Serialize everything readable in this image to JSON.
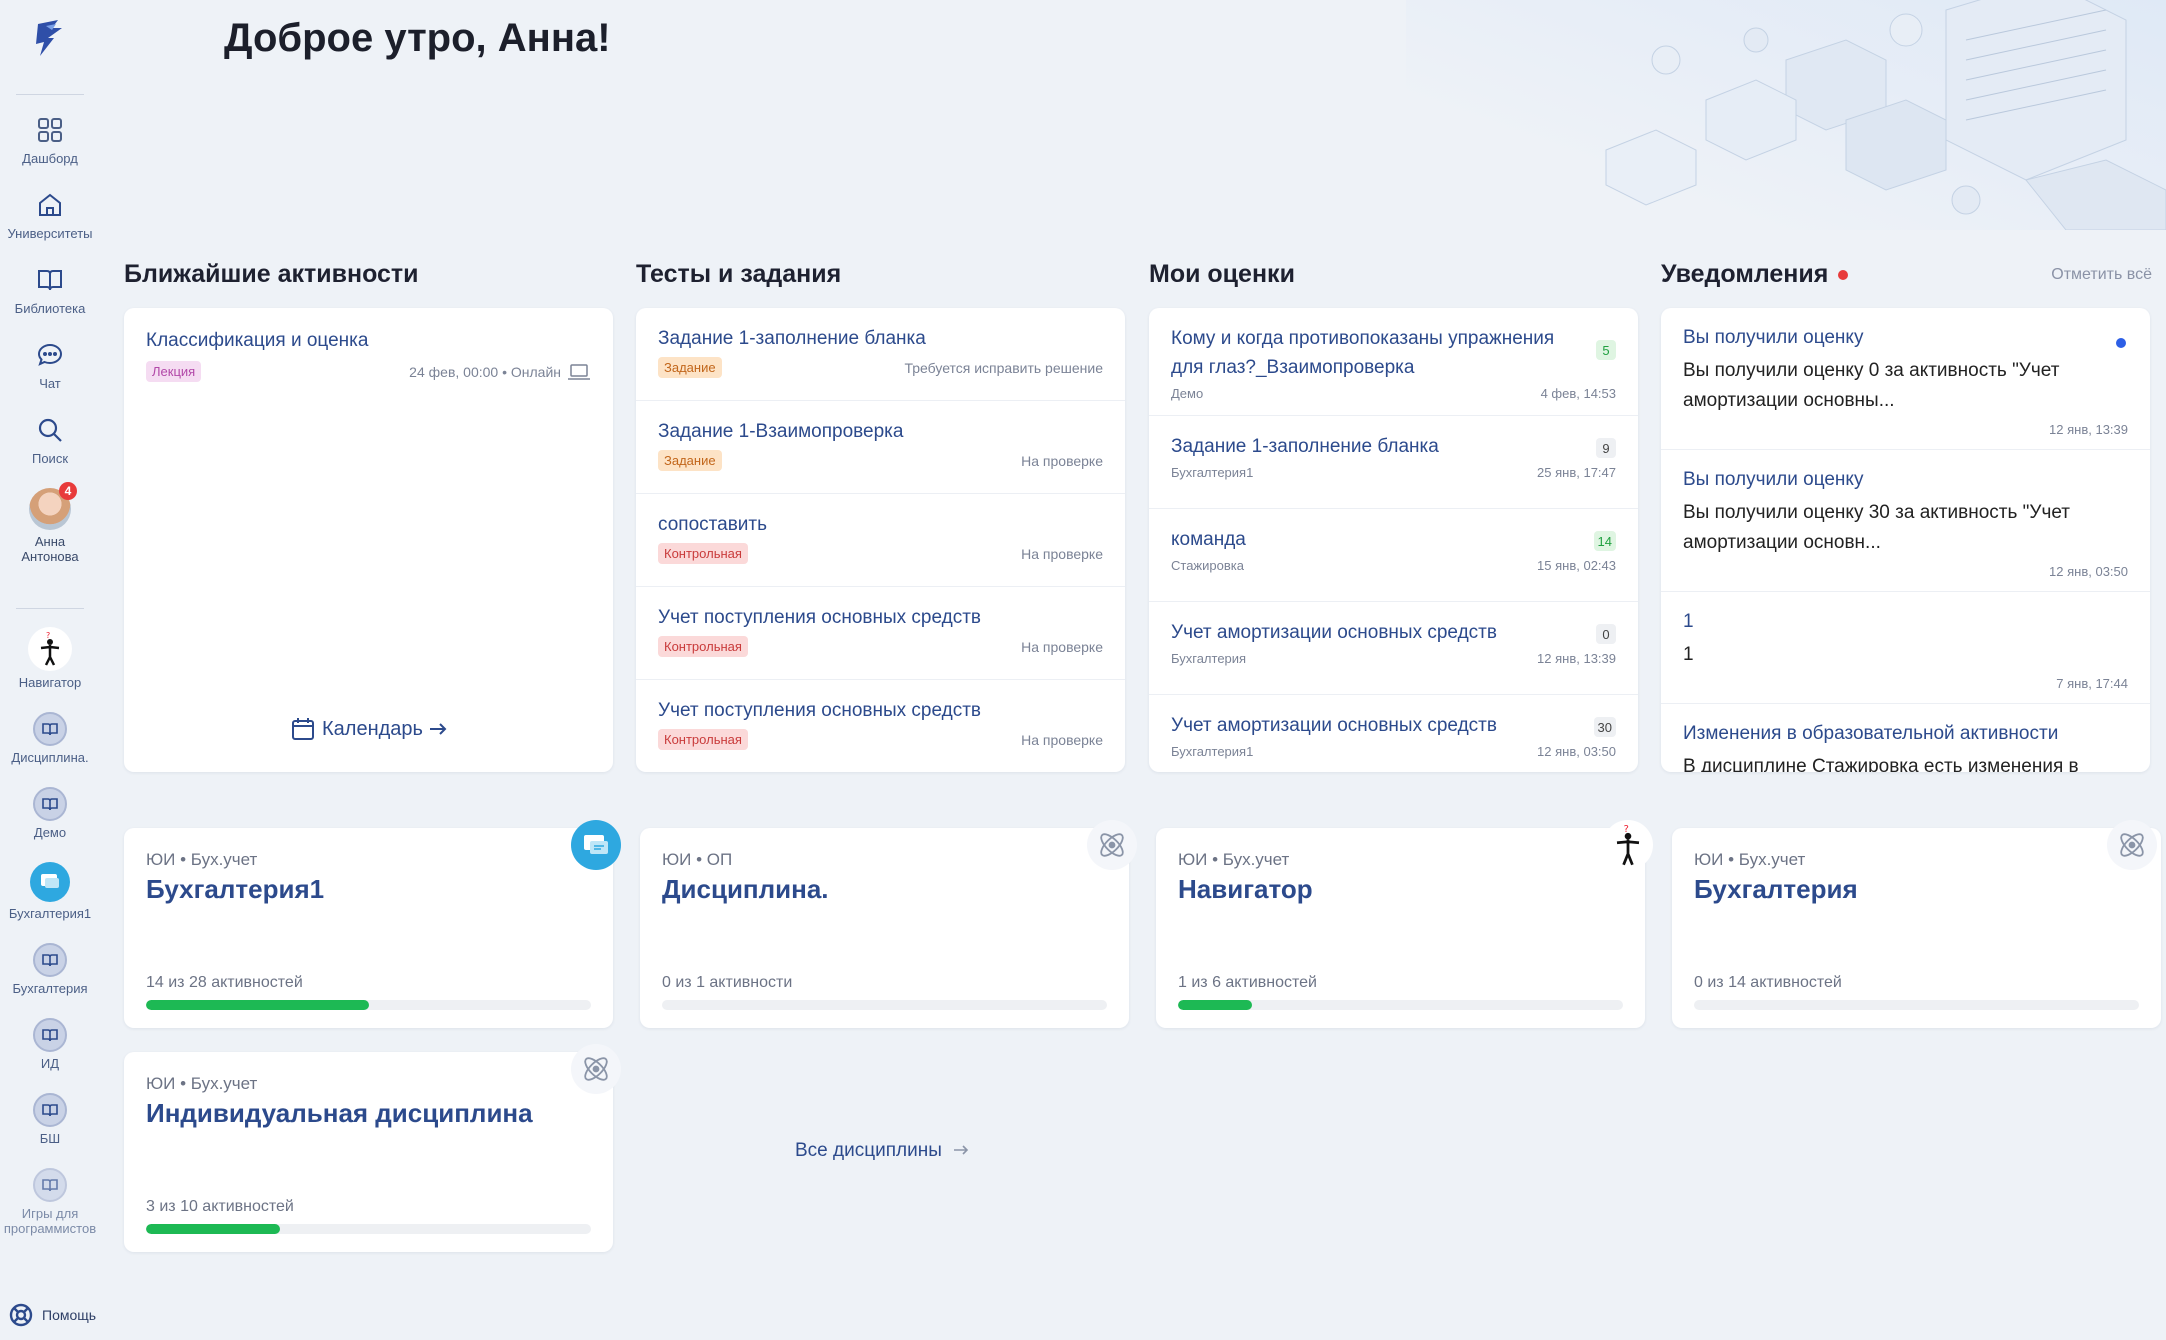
{
  "greeting": "Доброе утро, Анна!",
  "sidebar": {
    "items": [
      {
        "label": "Дашборд"
      },
      {
        "label": "Университеты"
      },
      {
        "label": "Библиотека"
      },
      {
        "label": "Чат"
      },
      {
        "label": "Поиск"
      }
    ],
    "user": {
      "name": "Анна Антонова",
      "badge": "4"
    },
    "disciplines": [
      {
        "label": "Навигатор"
      },
      {
        "label": "Дисциплина."
      },
      {
        "label": "Демо"
      },
      {
        "label": "Бухгалтерия1"
      },
      {
        "label": "Бухгалтерия"
      },
      {
        "label": "ИД"
      },
      {
        "label": "БШ"
      },
      {
        "label": "Игры для программистов"
      }
    ],
    "help": "Помощь"
  },
  "activities": {
    "title": "Ближайшие активности",
    "items": [
      {
        "name": "Классификация и оценка",
        "tag": "Лекция",
        "meta": "24 фев, 00:00 • Онлайн"
      }
    ],
    "calendar_link": "Календарь"
  },
  "tests": {
    "title": "Тесты и задания",
    "items": [
      {
        "name": "Задание 1-заполнение бланка",
        "tag": "Задание",
        "status": "Требуется исправить решение"
      },
      {
        "name": "Задание 1-Взаимопроверка",
        "tag": "Задание",
        "status": "На проверке"
      },
      {
        "name": "сопоставить",
        "tag": "Контрольная",
        "status": "На проверке"
      },
      {
        "name": "Учет поступления основных средств",
        "tag": "Контрольная",
        "status": "На проверке"
      },
      {
        "name": "Учет поступления основных средств",
        "tag": "Контрольная",
        "status": "На проверке"
      }
    ]
  },
  "grades": {
    "title": "Мои оценки",
    "items": [
      {
        "name": "Кому и когда противопоказаны упражнения для глаз?_Взаимопроверка",
        "score": "5",
        "course": "Демо",
        "date": "4 фев, 14:53"
      },
      {
        "name": "Задание 1-заполнение бланка",
        "score": "9",
        "course": "Бухгалтерия1",
        "date": "25 янв, 17:47"
      },
      {
        "name": "команда",
        "score": "14",
        "course": "Стажировка",
        "date": "15 янв, 02:43"
      },
      {
        "name": "Учет амортизации основных средств",
        "score": "0",
        "course": "Бухгалтерия",
        "date": "12 янв, 13:39"
      },
      {
        "name": "Учет амортизации основных средств",
        "score": "30",
        "course": "Бухгалтерия1",
        "date": "12 янв, 03:50"
      }
    ]
  },
  "notifications": {
    "title": "Уведомления",
    "mark_all": "Отметить всё",
    "items": [
      {
        "title": "Вы получили оценку",
        "body": "Вы получили оценку 0 за активность \"Учет амортизации основны...",
        "date": "12 янв, 13:39"
      },
      {
        "title": "Вы получили оценку",
        "body": "Вы получили оценку 30 за активность \"Учет амортизации основн...",
        "date": "12 янв, 03:50"
      },
      {
        "title": "1",
        "body": "1",
        "date": "7 янв, 17:44"
      },
      {
        "title": "Изменения в образовательной активности",
        "body": "В дисциплине Стажировка есть изменения в",
        "date": ""
      }
    ]
  },
  "disciplines": [
    {
      "crumb": "ЮИ • Бух.учет",
      "title": "Бухгалтерия1",
      "progress_text": "14 из 28 активностей",
      "progress": 0.5
    },
    {
      "crumb": "ЮИ • ОП",
      "title": "Дисциплина.",
      "progress_text": "0 из 1 активности",
      "progress": 0
    },
    {
      "crumb": "ЮИ • Бух.учет",
      "title": "Навигатор",
      "progress_text": "1 из 6 активностей",
      "progress": 0.167
    },
    {
      "crumb": "ЮИ • Бух.учет",
      "title": "Бухгалтерия",
      "progress_text": "0 из 14 активностей",
      "progress": 0
    },
    {
      "crumb": "ЮИ • Бух.учет",
      "title": "Индивидуальная дисциплина",
      "progress_text": "3 из 10 активностей",
      "progress": 0.3
    }
  ],
  "all_disciplines": "Все дисциплины",
  "colors": {
    "accent": "#2c4a8c",
    "progress": "#1db954",
    "alert": "#e83b3b"
  }
}
